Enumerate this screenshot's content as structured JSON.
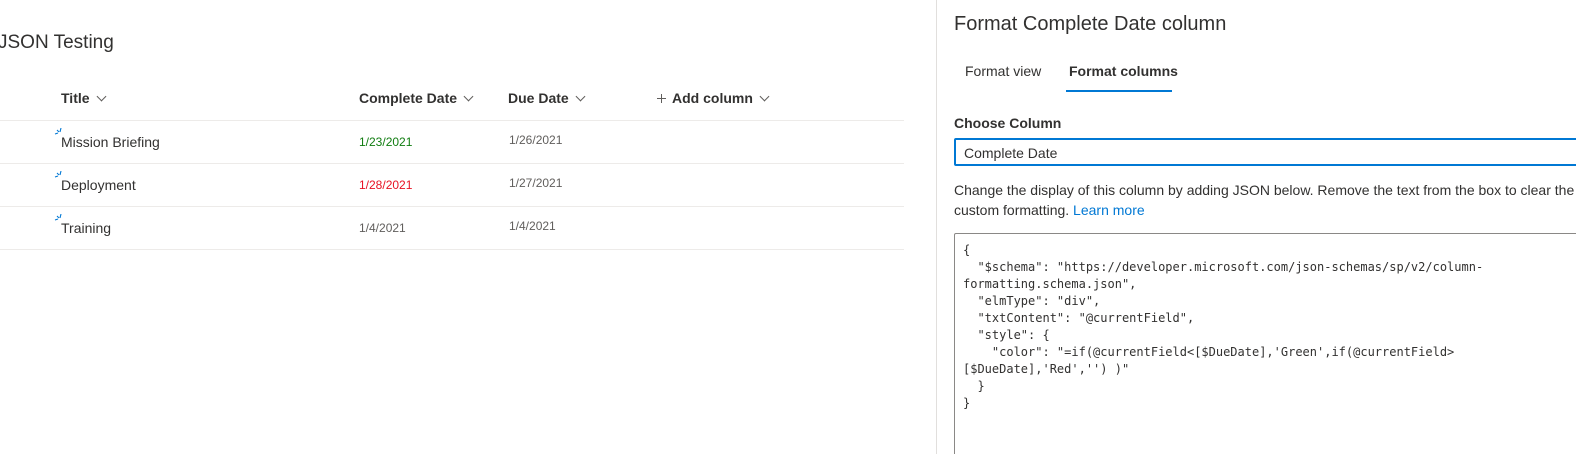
{
  "list": {
    "title": "JSON Testing",
    "columns": {
      "title": "Title",
      "complete_date": "Complete Date",
      "due_date": "Due Date",
      "add_column": "Add column"
    },
    "rows": [
      {
        "title": "Mission Briefing",
        "complete_date": "1/23/2021",
        "due_date": "1/26/2021"
      },
      {
        "title": "Deployment",
        "complete_date": "1/28/2021",
        "due_date": "1/27/2021"
      },
      {
        "title": "Training",
        "complete_date": "1/4/2021",
        "due_date": "1/4/2021"
      }
    ]
  },
  "colors": {
    "green": "#107c10",
    "red": "#e81123",
    "accent": "#0078d4"
  },
  "panel": {
    "title": "Format Complete Date column",
    "tabs": [
      {
        "label": "Format view"
      },
      {
        "label": "Format columns"
      }
    ],
    "choose_column_label": "Choose Column",
    "choose_column_value": "Complete Date",
    "help_text": "Change the display of this column by adding JSON below. Remove the text from the box to clear the custom formatting.",
    "learn_more": "Learn more",
    "json_lines": [
      "{",
      "  \"$schema\": \"https://developer.microsoft.com/json-schemas/sp/v2/column-",
      "formatting.schema.json\",",
      "  \"elmType\": \"div\",",
      "  \"txtContent\": \"@currentField\",",
      "  \"style\": {",
      "    \"color\": \"=if(@currentField<[$DueDate],'Green',if(@currentField>",
      "[$DueDate],'Red','') )\"",
      "  }",
      "}"
    ]
  }
}
